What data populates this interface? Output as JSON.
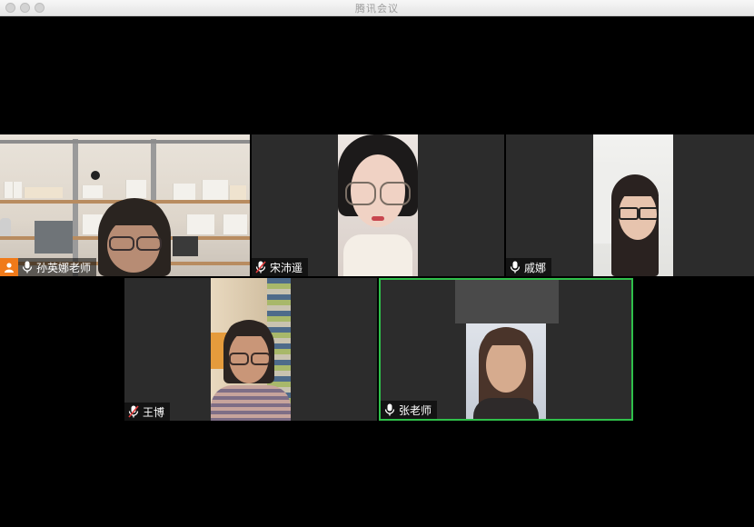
{
  "window": {
    "title": "腾讯会议"
  },
  "participants": [
    {
      "name": "孙英娜老师",
      "role": "host",
      "mic": "on",
      "active_speaker": false
    },
    {
      "name": "宋沛遥",
      "mic": "muted",
      "active_speaker": false
    },
    {
      "name": "戚娜",
      "mic": "on",
      "active_speaker": false
    },
    {
      "name": "王博",
      "mic": "muted",
      "active_speaker": false
    },
    {
      "name": "张老师",
      "mic": "on",
      "active_speaker": true
    }
  ],
  "icons": {
    "host": "person-icon",
    "mic_on": "microphone-icon",
    "mic_muted": "microphone-muted-icon"
  },
  "colors": {
    "active_speaker_border": "#2fbf4a",
    "host_badge": "#f07a1a",
    "tile_background": "#2c2c2c",
    "muted_mic": "#e03a3a"
  }
}
